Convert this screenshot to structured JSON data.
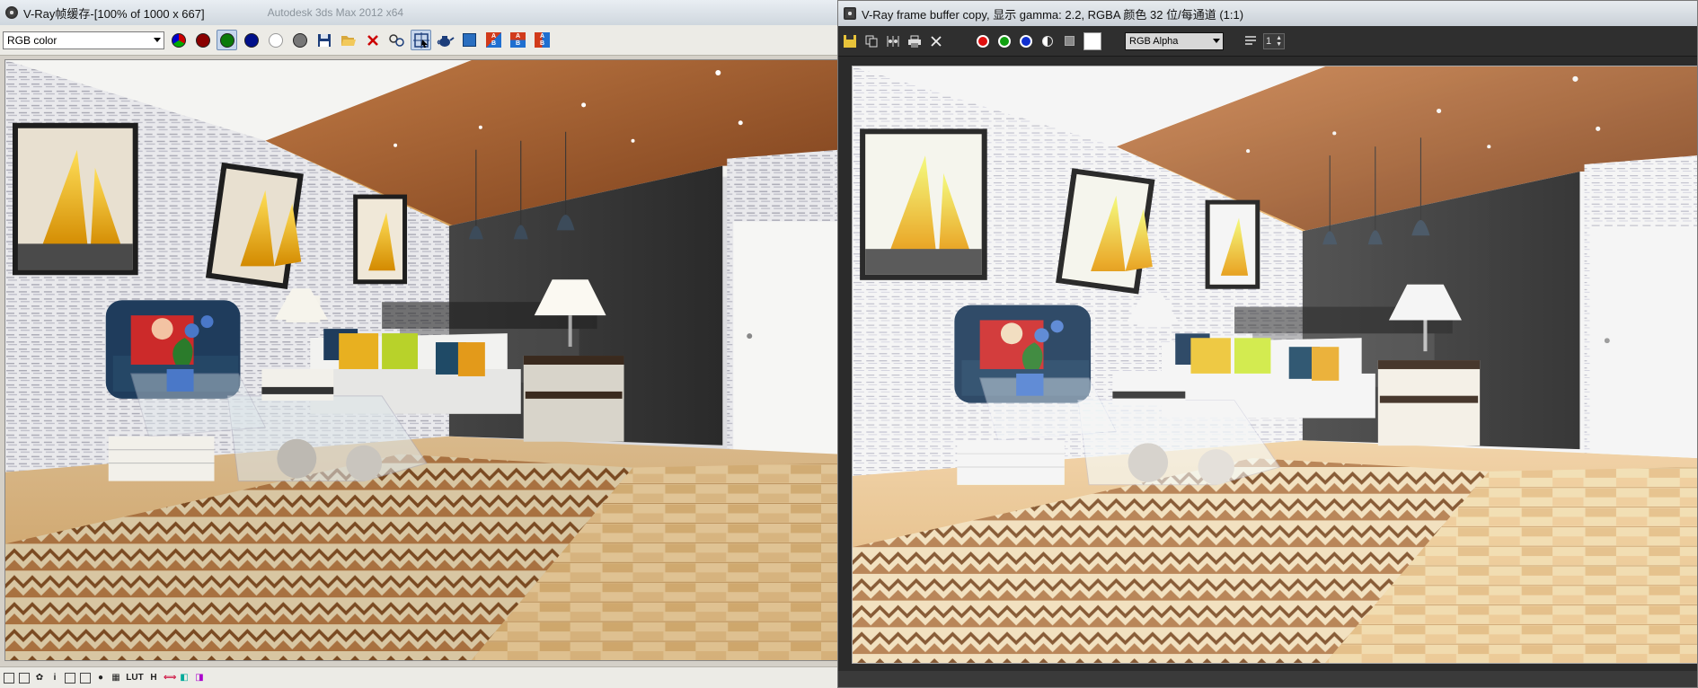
{
  "left_window": {
    "title": "V-Ray帧缓存-[100% of 1000 x 667]",
    "ghost_title": "Autodesk 3ds Max 2012 x64",
    "channel_select": "RGB color",
    "ab_label": "A",
    "ab_label2": "B",
    "statusbar": {
      "info_glyph": "i",
      "luts_label": "LUT",
      "h_label": "H"
    }
  },
  "right_window": {
    "title": "V-Ray frame buffer copy, 显示 gamma: 2.2, RGBA 颜色 32 位/每通道 (1:1)",
    "channel_select": "RGB Alpha",
    "zoom_value": "1"
  },
  "colors": {
    "red": "#8a0000",
    "green": "#0a7a0a",
    "blue": "#00108a",
    "accent_select": "#6f8db5"
  }
}
